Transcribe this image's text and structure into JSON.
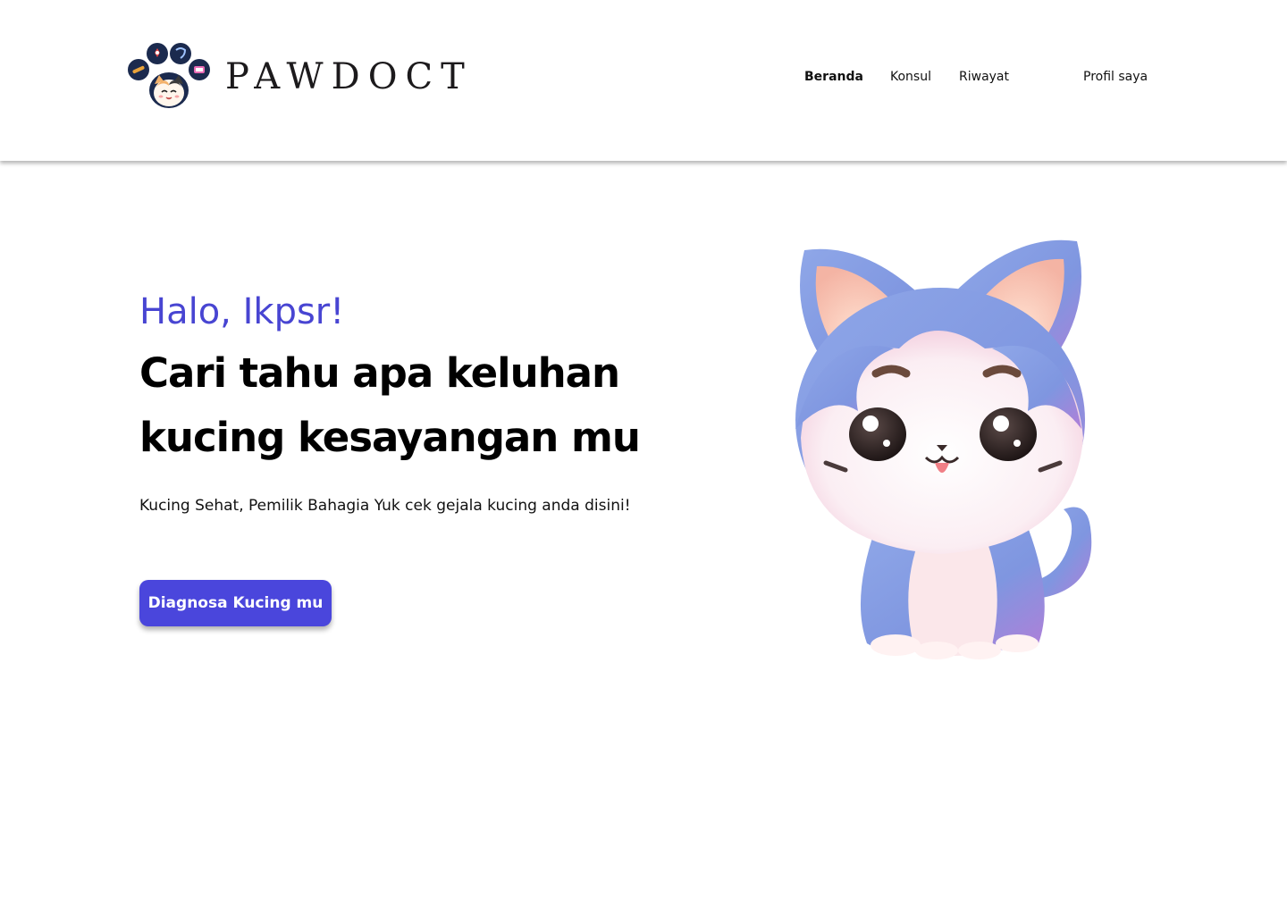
{
  "brand": {
    "name": "PAWDOCT",
    "logo_icon": "paw-cat-logo-icon"
  },
  "nav": {
    "items": [
      {
        "label": "Beranda",
        "active": true
      },
      {
        "label": "Konsul",
        "active": false
      },
      {
        "label": "Riwayat",
        "active": false
      }
    ],
    "profile_label": "Profil saya"
  },
  "hero": {
    "greeting": "Halo, Ikpsr!",
    "title": "Cari tahu apa keluhan kucing kesayangan mu",
    "subtitle": "Kucing Sehat, Pemilik Bahagia Yuk cek gejala kucing anda disini!",
    "cta_label": "Diagnosa Kucing mu",
    "illustration": "blue-cat-illustration"
  },
  "colors": {
    "accent": "#4a46dc",
    "greeting": "#4845d2",
    "logo_navy": "#1b2a4e",
    "text": "#000000"
  }
}
